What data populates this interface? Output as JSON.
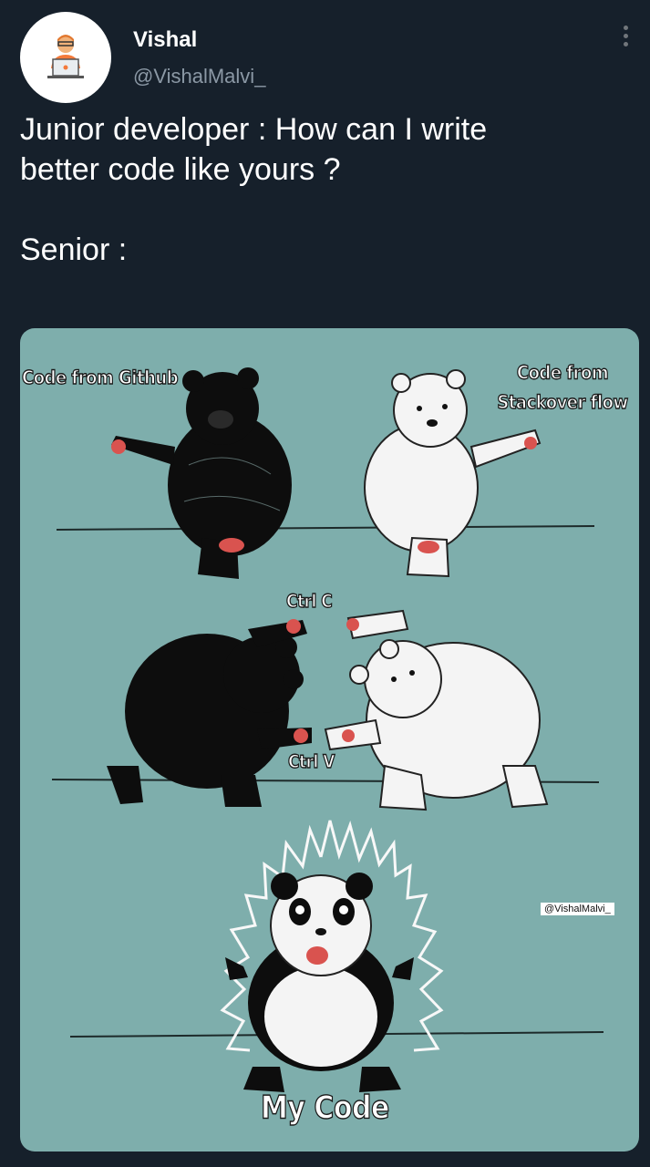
{
  "tweet": {
    "author_name": "Vishal",
    "author_handle": "@VishalMalvi_",
    "text": "Junior developer : How can I write\nbetter code like yours ?\n\nSenior :"
  },
  "meme": {
    "label_github": "Code from Github",
    "label_stackoverflow": "Code from\nStackover flow",
    "label_ctrl_c": "Ctrl C",
    "label_ctrl_v": "Ctrl V",
    "label_my_code": "My Code",
    "watermark": "@VishalMalvi_",
    "background_color": "#7eaeac"
  },
  "icons": {
    "avatar": "developer-laptop-avatar",
    "more": "more-vertical-icon"
  }
}
